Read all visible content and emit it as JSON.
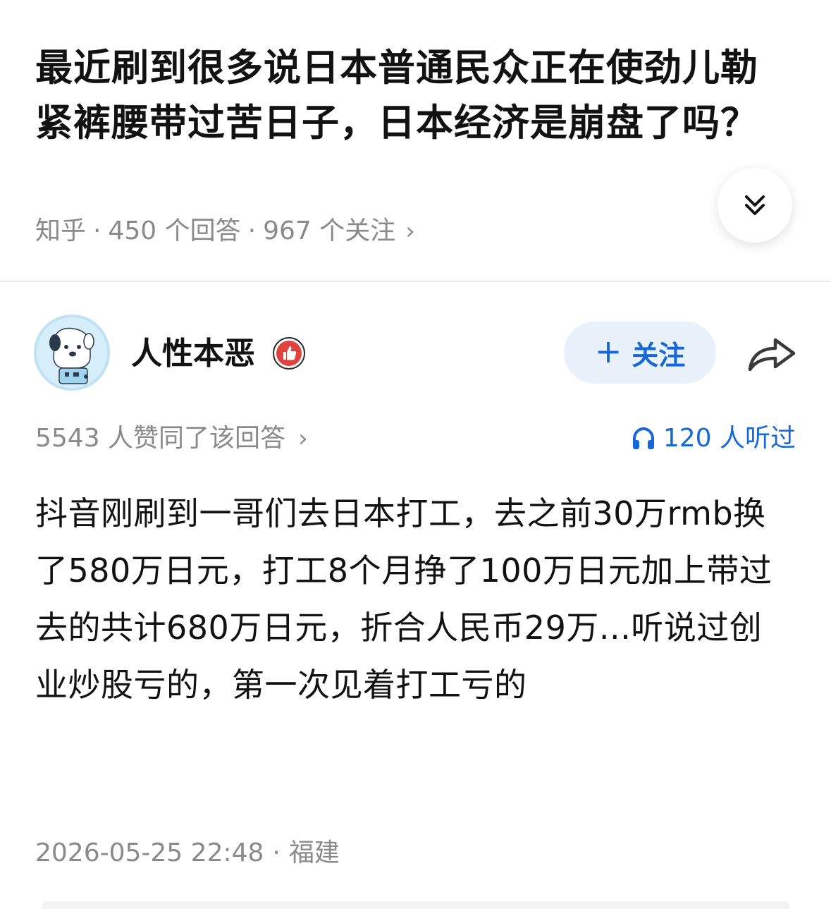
{
  "question": {
    "title": "最近刷到很多说日本普通民众正在使劲儿勒紧裤腰带过苦日子，日本经济是崩盘了吗？",
    "source": "知乎",
    "separator": "·",
    "answers": "450 个回答",
    "followers": "967 个关注",
    "chevron": "›"
  },
  "author": {
    "name": "人性本恶",
    "badge_icon": "thumbs-up-badge-icon"
  },
  "follow_button": {
    "plus": "+",
    "label": "关注"
  },
  "answer": {
    "upvotes": "5543 人赞同了该回答",
    "listeners": "120 人听过",
    "body": "抖音刚刷到一哥们去日本打工，去之前30万rmb换了580万日元，打工8个月挣了100万日元加上带过去的共计680万日元，折合人民币29万...听说过创业炒股亏的，第一次见着打工亏的",
    "timestamp": "2026-05-25 22:48",
    "location": "福建"
  },
  "colors": {
    "accent": "#1767d8",
    "follow_bg": "#e9f1fb",
    "meta_text": "#8a8a8a",
    "badge_red": "#e0433d"
  }
}
